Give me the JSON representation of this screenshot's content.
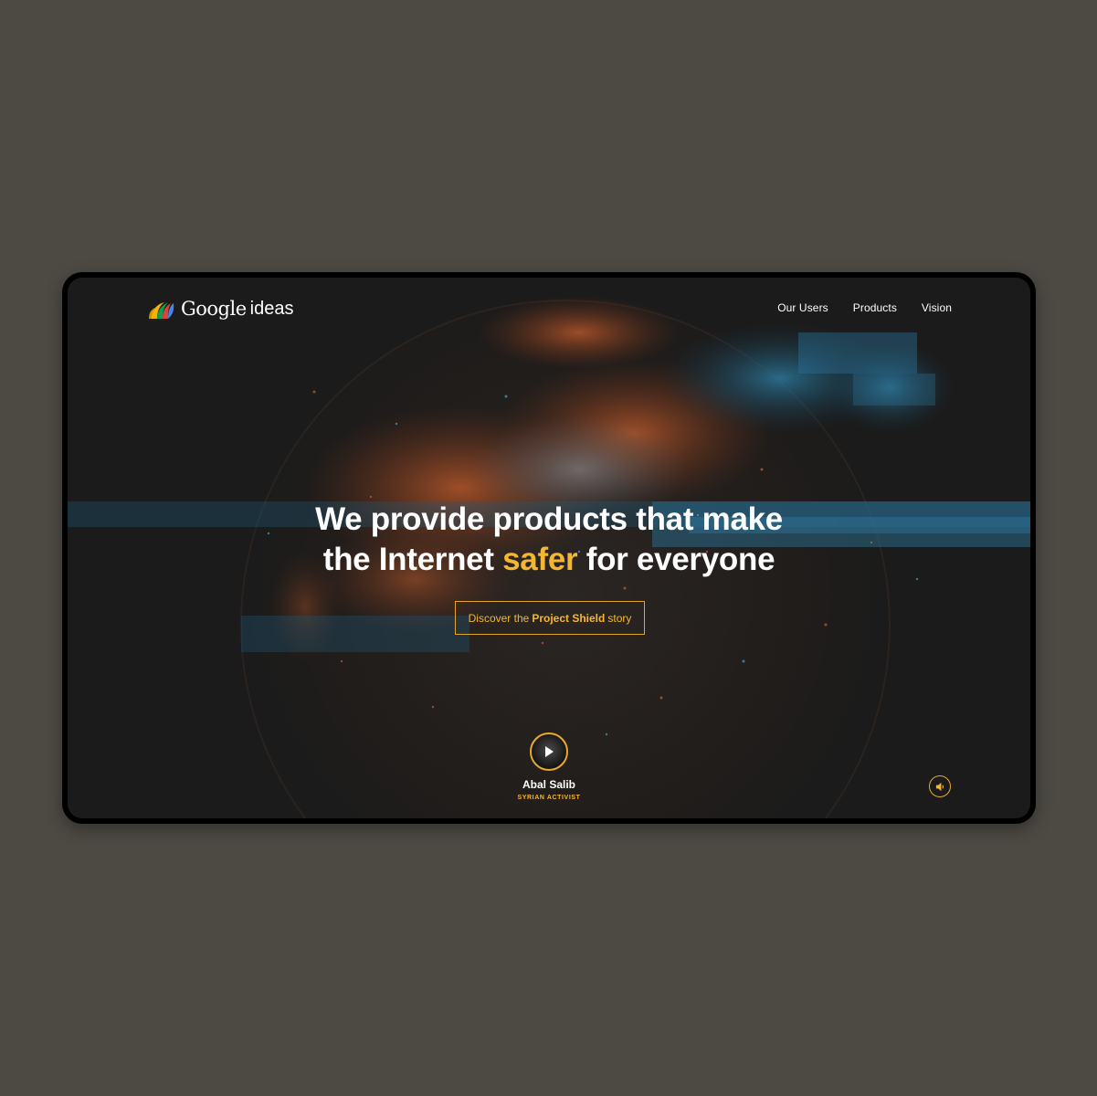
{
  "brand": {
    "name": "Google",
    "product": "ideas"
  },
  "nav": {
    "items": [
      {
        "label": "Our Users"
      },
      {
        "label": "Products"
      },
      {
        "label": "Vision"
      }
    ]
  },
  "hero": {
    "line1": "We provide products that make",
    "line2_before": "the Internet ",
    "line2_accent": "safer",
    "line2_after": " for everyone",
    "cta_prefix": "Discover the",
    "cta_bold": "Project Shield",
    "cta_suffix": "story"
  },
  "testimonial": {
    "name": "Abal Salib",
    "role": "SYRIAN ACTIVIST"
  },
  "icons": {
    "logo": "google-ideas-logo-icon",
    "play": "play-icon",
    "sound": "speaker-icon"
  },
  "colors": {
    "page_background": "#4d4a44",
    "screen_background": "#1b1b1b",
    "accent": "#f5b731",
    "text": "#ffffff",
    "globe_orange": "#a04a22",
    "globe_blue": "#1f5a78"
  }
}
